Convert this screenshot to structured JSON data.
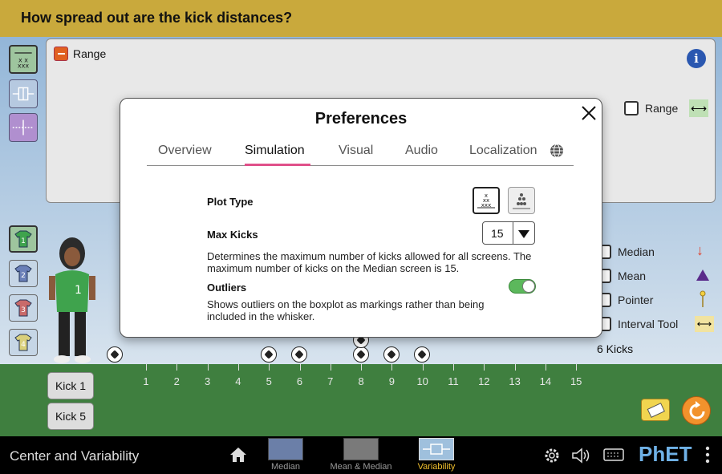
{
  "header": {
    "question": "How spread out are the kick distances?"
  },
  "panel": {
    "range_label": "Range"
  },
  "legend": {
    "range": "Range",
    "median": "Median",
    "mean": "Mean",
    "pointer": "Pointer",
    "interval_tool": "Interval Tool",
    "kicks_count": "6 Kicks"
  },
  "players": [
    "1",
    "2",
    "3",
    "4"
  ],
  "number_line": {
    "ticks": [
      "1",
      "2",
      "3",
      "4",
      "5",
      "6",
      "7",
      "8",
      "9",
      "10",
      "11",
      "12",
      "13",
      "14",
      "15"
    ]
  },
  "kick_buttons": {
    "kick1": "Kick 1",
    "kick5": "Kick 5"
  },
  "preferences": {
    "title": "Preferences",
    "tabs": [
      "Overview",
      "Simulation",
      "Visual",
      "Audio",
      "Localization"
    ],
    "active_tab": "Simulation",
    "plot_type_label": "Plot Type",
    "max_kicks_label": "Max Kicks",
    "max_kicks_value": "15",
    "max_kicks_desc": "Determines the maximum number of kicks allowed for all screens. The maximum number of kicks on the Median screen is 15.",
    "outliers_label": "Outliers",
    "outliers_enabled": true,
    "outliers_desc": "Shows outliers on the boxplot as markings rather than being included in the whisker."
  },
  "navbar": {
    "app_title": "Center and Variability",
    "screens": [
      "Median",
      "Mean & Median",
      "Variability"
    ],
    "active_screen": "Variability",
    "logo": "PhET"
  },
  "colors": {
    "banner": "#c9a93c",
    "grass": "#3f7f3f",
    "accent_tab": "#e0508a",
    "toggle_on": "#5cb85c",
    "median_arrow": "#e0402a",
    "mean_triangle": "#5a2a8a"
  }
}
